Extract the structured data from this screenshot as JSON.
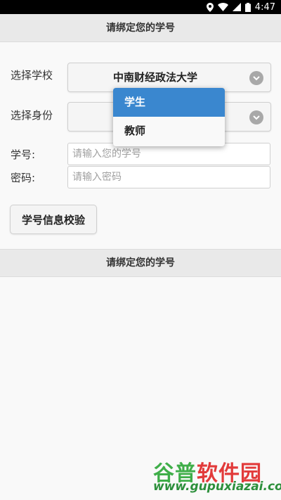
{
  "statusbar": {
    "time": "4:47"
  },
  "header": {
    "title": "请绑定您的学号"
  },
  "form": {
    "school_label": "选择学校",
    "school_value": "中南财经政法大学",
    "identity_label": "选择身份",
    "id_label": "学号:",
    "id_placeholder": "请输入您的学号",
    "password_label": "密码:",
    "password_placeholder": "请输入密码",
    "verify_button": "学号信息校验"
  },
  "footer_bar": {
    "title": "请绑定您的学号"
  },
  "dropdown": {
    "options": [
      "学生",
      "教师"
    ],
    "selected": "学生"
  },
  "watermark": {
    "line1_a": "谷普",
    "line1_b": "软件园",
    "url": "www.gupuxiazai.com"
  },
  "colors": {
    "selected_option": "#3a87cf",
    "header_bg": "#e9e9e9"
  }
}
